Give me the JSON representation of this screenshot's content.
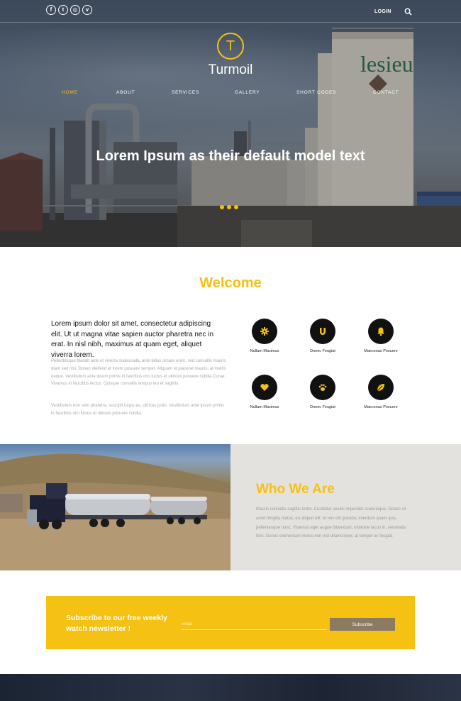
{
  "header": {
    "social_icons": [
      {
        "name": "facebook-icon",
        "glyph": "f"
      },
      {
        "name": "twitter-icon",
        "glyph": "t"
      },
      {
        "name": "instagram-icon",
        "glyph": "◎"
      },
      {
        "name": "vimeo-icon",
        "glyph": "v"
      }
    ],
    "login_label": "LOGIN",
    "search_icon": "search-icon",
    "logo_letter": "T",
    "brand": "Turmoil"
  },
  "nav": {
    "items": [
      {
        "label": "HOME",
        "active": true
      },
      {
        "label": "ABOUT",
        "active": false
      },
      {
        "label": "SERVICES",
        "active": false
      },
      {
        "label": "GALLERY",
        "active": false
      },
      {
        "label": "SHORT CODES",
        "active": false
      },
      {
        "label": "CONTACT",
        "active": false
      }
    ]
  },
  "hero": {
    "title": "Lorem Ipsum as their default model text",
    "slides": 3,
    "tank_sign": "lesieu"
  },
  "welcome": {
    "title": "Welcome",
    "lead": "Lorem ipsum dolor sit amet, consectetur adipiscing elit. Ut ut magna vitae sapien auctor pharetra nec in erat. In nisl nibh, maximus at quam eget, aliquet viverra lorem.",
    "paragraph1": "Pellentesque blandit ante et viverra malesuada, ante tellus ornare enim, sed convallis mauris diam sed nisi. Donec eleifend et lorem posuere semper. Aliquam et placerat mauris, at mattis neque. Vestibulum ante ipsum primis in faucibus orci luctus et ultrices posuere cubilia Curae; Vivamus in faucibus lectus. Quisque convallis tempus leo et sagittis.",
    "paragraph2": "Vestibulum non sem pharetra, suscipit turpis eu, ultrices justo. Vestibulum ante ipsum primis in faucibus orci luctus et ultrices posuere cubilia.",
    "features": [
      {
        "label": "Nullam Maximus",
        "icon": "gear-icon"
      },
      {
        "label": "Donec Feugiat",
        "icon": "magnet-icon"
      },
      {
        "label": "Maecenas Posuere",
        "icon": "bell-icon"
      },
      {
        "label": "Nullam Maximus",
        "icon": "heart-icon"
      },
      {
        "label": "Donec Feugiat",
        "icon": "paw-icon"
      },
      {
        "label": "Maecenas Posuere",
        "icon": "leaf-icon"
      }
    ]
  },
  "who": {
    "title": "Who We Are",
    "text": "Mauris convallis sagittis tortor. Curabitur iaculis imperdiet scelerisque. Donec sit amet fringilla metus, eu aliquet elit. In nec elit gravida, interdum quam quis, pellentesque nunc. Vivamus eget augue bibendum, molestie lacus in, venenatis felis. Donec elementum metus non nisl ullamcorper, at tempor ex feugiat."
  },
  "subscribe": {
    "text": "Subscribe to our free weekly watch newsletter !",
    "email_placeholder": "Email",
    "button_label": "Subscribe"
  },
  "colors": {
    "accent": "#f5c113",
    "dark": "#111111",
    "button": "#8a7b62"
  }
}
